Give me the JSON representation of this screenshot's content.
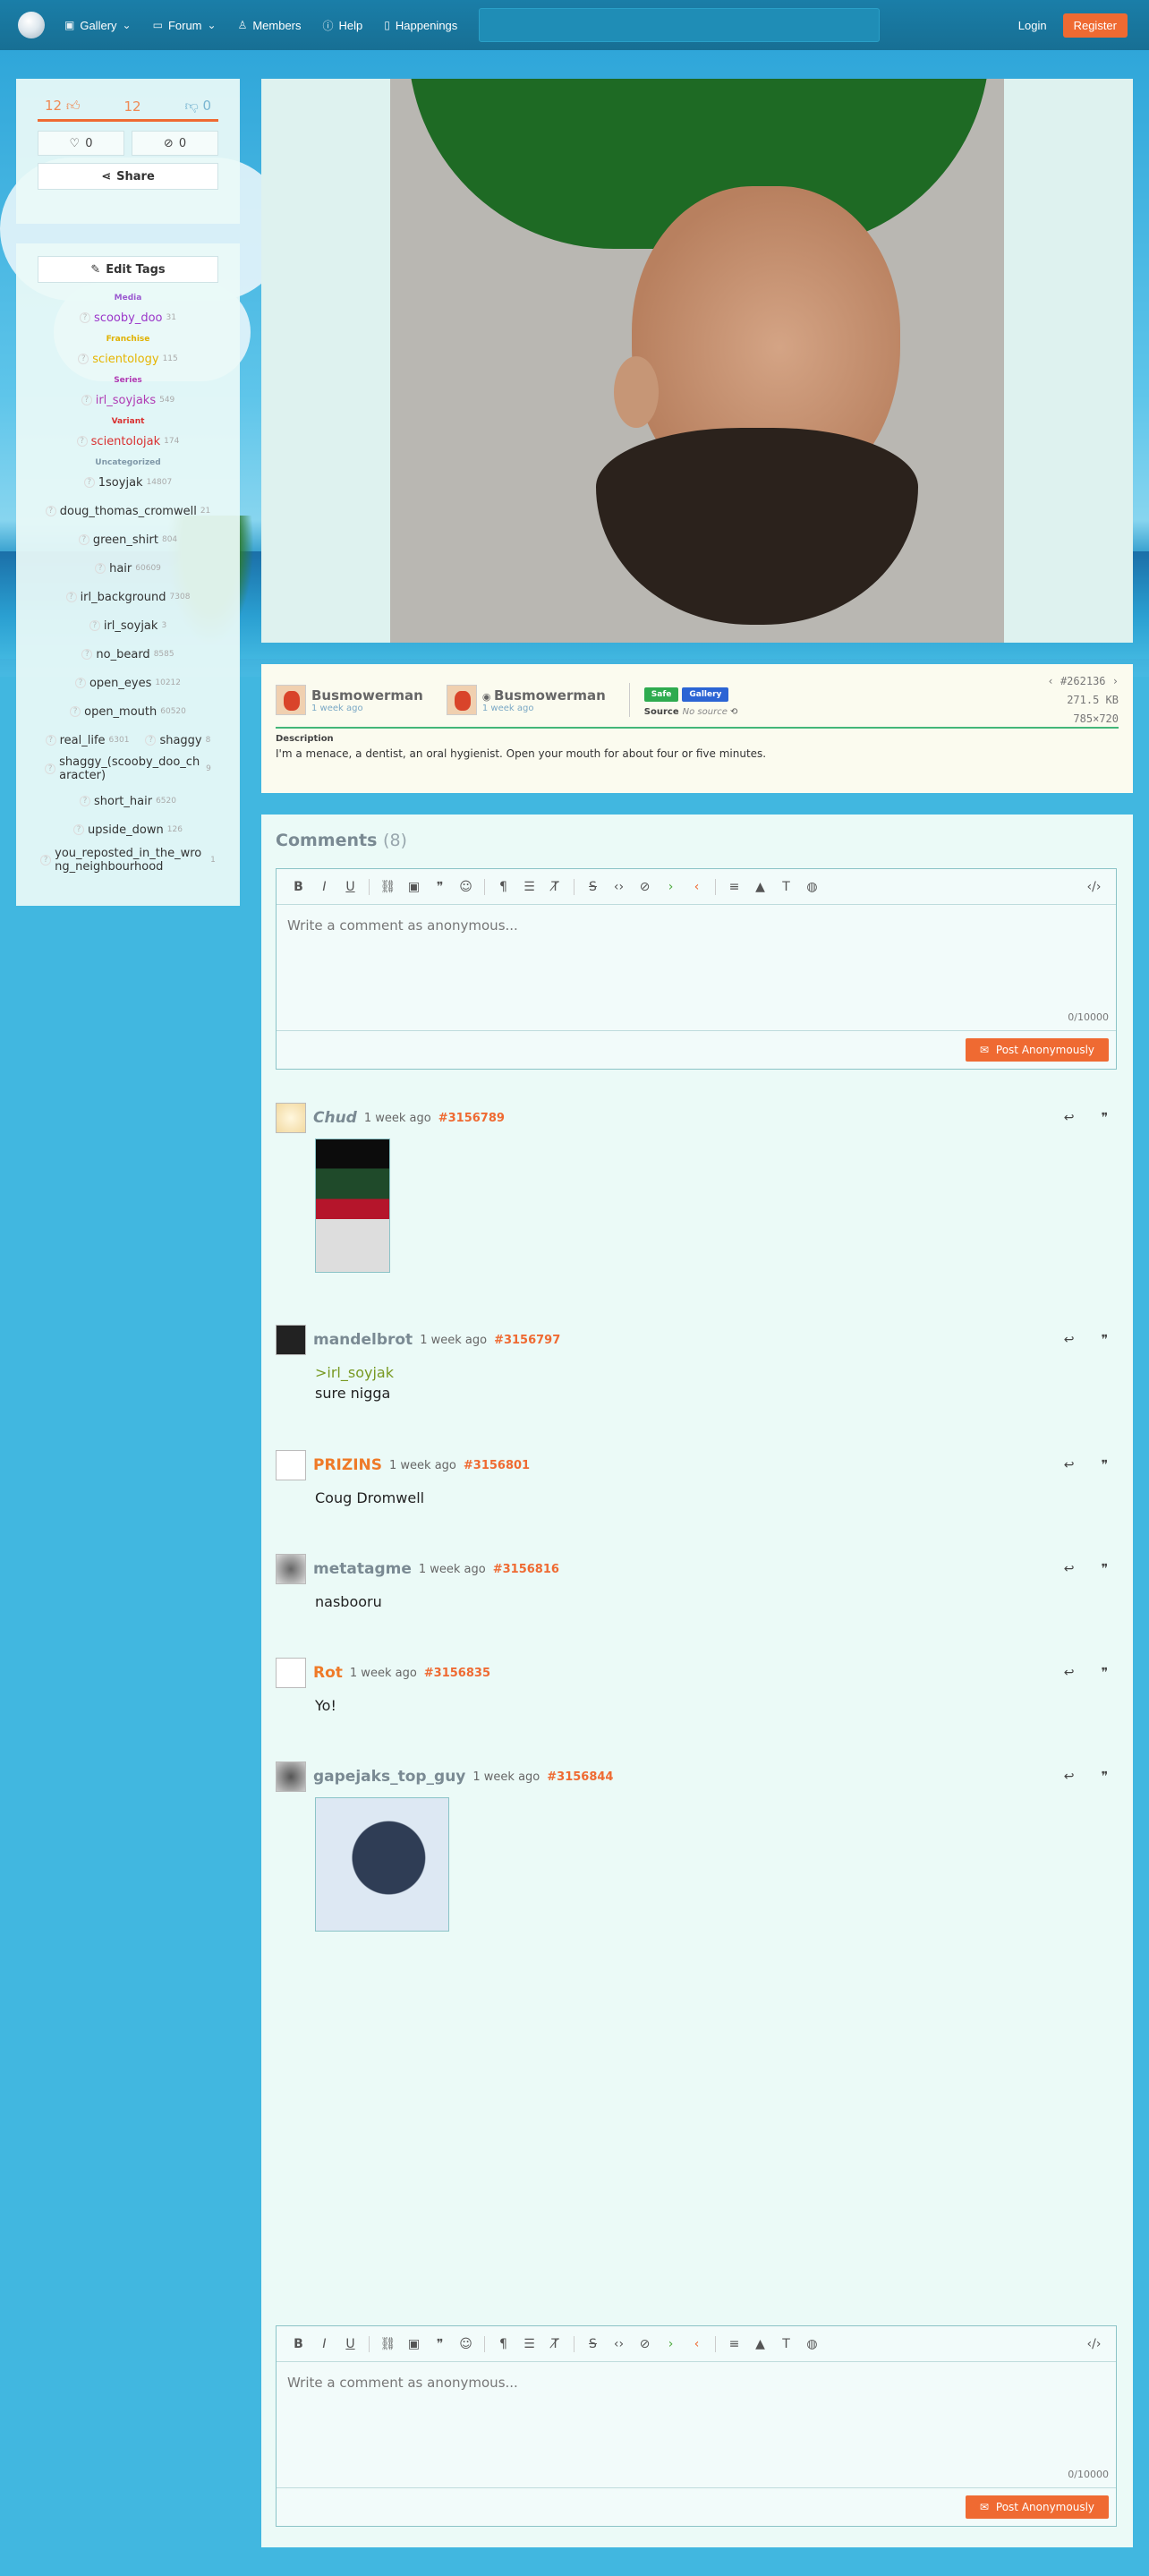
{
  "nav": {
    "gallery": "Gallery",
    "forum": "Forum",
    "members": "Members",
    "help": "Help",
    "happenings": "Happenings",
    "login": "Login",
    "register": "Register"
  },
  "stats": {
    "upvotes": "12",
    "score": "12",
    "downvotes": "0",
    "favorites": "0",
    "hides": "0",
    "share_label": "Share"
  },
  "tags": {
    "edit_label": "Edit Tags",
    "categories": {
      "media": "Media",
      "franchise": "Franchise",
      "series": "Series",
      "variant": "Variant",
      "uncategorized": "Uncategorized"
    },
    "media": [
      {
        "name": "scooby_doo",
        "count": "31"
      }
    ],
    "franchise": [
      {
        "name": "scientology",
        "count": "115"
      }
    ],
    "series": [
      {
        "name": "irl_soyjaks",
        "count": "549"
      }
    ],
    "variant": [
      {
        "name": "scientolojak",
        "count": "174"
      }
    ],
    "uncategorized": [
      {
        "name": "1soyjak",
        "count": "14807"
      },
      {
        "name": "doug_thomas_cromwell",
        "count": "21"
      },
      {
        "name": "green_shirt",
        "count": "804"
      },
      {
        "name": "hair",
        "count": "60609"
      },
      {
        "name": "irl_background",
        "count": "7308"
      },
      {
        "name": "irl_soyjak",
        "count": "3"
      },
      {
        "name": "no_beard",
        "count": "8585"
      },
      {
        "name": "open_eyes",
        "count": "10212"
      },
      {
        "name": "open_mouth",
        "count": "60520"
      },
      {
        "name": "real_life",
        "count": "6301"
      },
      {
        "name": "shaggy",
        "count": "8"
      },
      {
        "name": "shaggy_(scooby_doo_character)",
        "count": "9"
      },
      {
        "name": "short_hair",
        "count": "6520"
      },
      {
        "name": "upside_down",
        "count": "126"
      },
      {
        "name": "you_reposted_in_the_wrong_neighbourhood",
        "count": "1"
      }
    ]
  },
  "post": {
    "uploader": "Busmowerman",
    "uploader_time": "1 week ago",
    "op": "Busmowerman",
    "op_time": "1 week ago",
    "rating_badge": "Safe",
    "gallery_badge": "Gallery",
    "source_label": "Source",
    "source_value": "No source",
    "id": "#262136",
    "size": "271.5 KB",
    "dimensions": "785×720",
    "description_label": "Description",
    "description": "I'm a menace, a dentist, an oral hygienist. Open your mouth for about four or five minutes."
  },
  "comments": {
    "title": "Comments",
    "count": "(8)",
    "placeholder": "Write a comment as anonymous...",
    "counter": "0/10000",
    "post_label": "Post Anonymously",
    "items": [
      {
        "user": "Chud",
        "time": "1 week ago",
        "id": "#3156789"
      },
      {
        "user": "mandelbrot",
        "time": "1 week ago",
        "id": "#3156797",
        "greentext": ">irl_soyjak",
        "text": "sure nigga"
      },
      {
        "user": "PRIZINS",
        "time": "1 week ago",
        "id": "#3156801",
        "text": "Coug Dromwell"
      },
      {
        "user": "metatagme",
        "time": "1 week ago",
        "id": "#3156816",
        "text": "nasbooru"
      },
      {
        "user": "Rot",
        "time": "1 week ago",
        "id": "#3156835",
        "text": "Yo!"
      },
      {
        "user": "gapejaks_top_guy",
        "time": "1 week ago",
        "id": "#3156844"
      }
    ]
  },
  "colors": {
    "accent": "#ef6a32",
    "nav_bg": "#1a7ea8",
    "page_bg": "#41b7e0"
  }
}
